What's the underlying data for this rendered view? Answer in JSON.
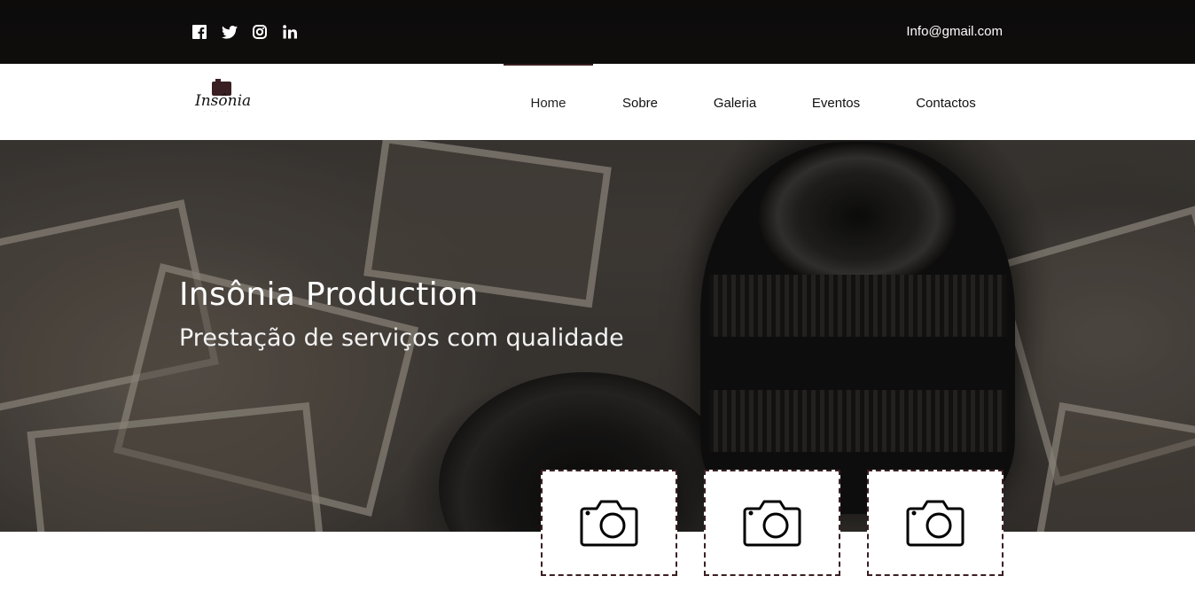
{
  "topbar": {
    "social": [
      {
        "icon": "facebook-icon"
      },
      {
        "icon": "twitter-icon"
      },
      {
        "icon": "instagram-icon"
      },
      {
        "icon": "linkedin-icon"
      }
    ],
    "email": "Info@gmail.com"
  },
  "logo": {
    "text": "Insônia"
  },
  "nav": {
    "items": [
      {
        "label": "Home",
        "active": true
      },
      {
        "label": "Sobre",
        "active": false
      },
      {
        "label": "Galeria",
        "active": false
      },
      {
        "label": "Eventos",
        "active": false
      },
      {
        "label": "Contactos",
        "active": false
      }
    ]
  },
  "hero": {
    "title": "Insônia Production",
    "subtitle": "Prestação de serviços com qualidade"
  },
  "features": [
    {
      "icon": "camera-icon"
    },
    {
      "icon": "camera-icon"
    },
    {
      "icon": "camera-icon"
    }
  ],
  "colors": {
    "accent": "#3a1f22",
    "topbar": "#000000",
    "nav_bg": "#ffffff"
  }
}
